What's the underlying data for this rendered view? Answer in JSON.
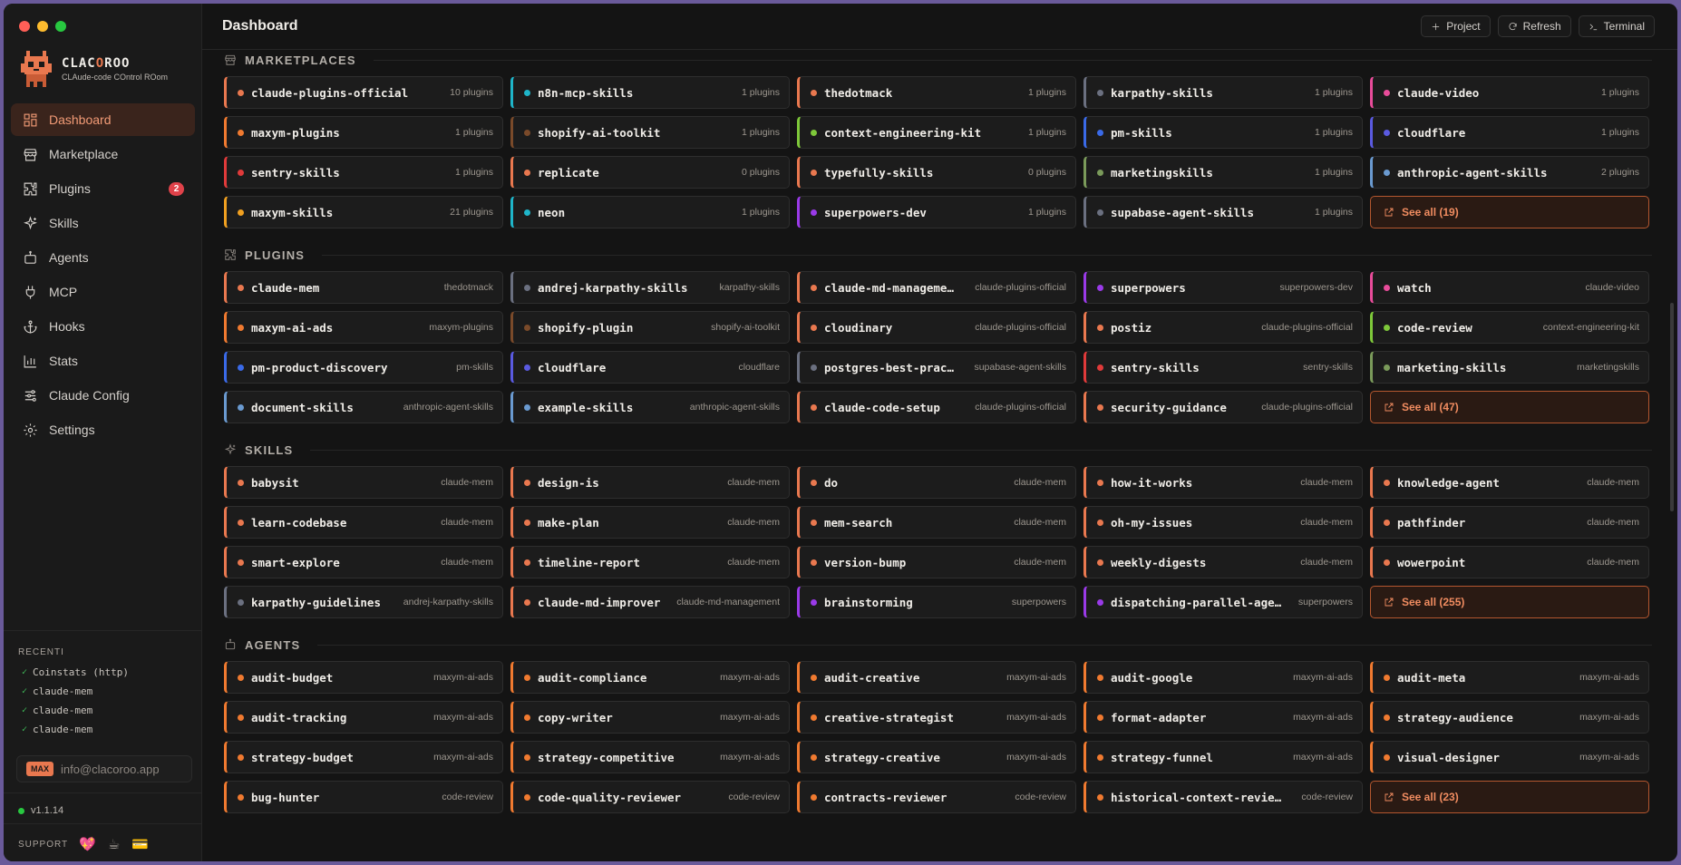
{
  "app": {
    "brand_name_a": "CLAC",
    "brand_name_b": "O",
    "brand_name_c": "ROO",
    "brand_sub": "CLAude-code COntrol ROom"
  },
  "sidebar": {
    "items": [
      {
        "id": "dashboard",
        "label": "Dashboard",
        "icon": "dashboard-icon",
        "active": true
      },
      {
        "id": "marketplace",
        "label": "Marketplace",
        "icon": "store-icon"
      },
      {
        "id": "plugins",
        "label": "Plugins",
        "icon": "puzzle-icon",
        "badge": "2"
      },
      {
        "id": "skills",
        "label": "Skills",
        "icon": "sparkles-icon"
      },
      {
        "id": "agents",
        "label": "Agents",
        "icon": "robot-icon"
      },
      {
        "id": "mcp",
        "label": "MCP",
        "icon": "plug-icon"
      },
      {
        "id": "hooks",
        "label": "Hooks",
        "icon": "anchor-icon"
      },
      {
        "id": "stats",
        "label": "Stats",
        "icon": "bar-chart-icon"
      },
      {
        "id": "claude-config",
        "label": "Claude Config",
        "icon": "sliders-icon"
      },
      {
        "id": "settings",
        "label": "Settings",
        "icon": "gear-icon"
      }
    ],
    "recent_title": "RECENTI",
    "recent": [
      "Coinstats (http)",
      "claude-mem",
      "claude-mem",
      "claude-mem"
    ],
    "plan_badge": "MAX",
    "email": "info@clacoroo.app",
    "version": "v1.1.14",
    "support_label": "SUPPORT"
  },
  "header": {
    "title": "Dashboard",
    "actions": [
      {
        "id": "project",
        "label": "Project",
        "icon": "plus-icon"
      },
      {
        "id": "refresh",
        "label": "Refresh",
        "icon": "refresh-icon"
      },
      {
        "id": "terminal",
        "label": "Terminal",
        "icon": "terminal-icon"
      }
    ]
  },
  "sections": [
    {
      "id": "marketplaces",
      "title": "MARKETPLACES",
      "icon": "store-icon",
      "cards": [
        {
          "name": "claude-plugins-official",
          "meta": "10 plugins",
          "color": "#e9784f"
        },
        {
          "name": "n8n-mcp-skills",
          "meta": "1 plugins",
          "color": "#1fb5c9"
        },
        {
          "name": "thedotmack",
          "meta": "1 plugins",
          "color": "#e9784f"
        },
        {
          "name": "karpathy-skills",
          "meta": "1 plugins",
          "color": "#6b7080"
        },
        {
          "name": "claude-video",
          "meta": "1 plugins",
          "color": "#e84c9a"
        },
        {
          "name": "maxym-plugins",
          "meta": "1 plugins",
          "color": "#f07a30"
        },
        {
          "name": "shopify-ai-toolkit",
          "meta": "1 plugins",
          "color": "#7a4a2a"
        },
        {
          "name": "context-engineering-kit",
          "meta": "1 plugins",
          "color": "#7ec83a"
        },
        {
          "name": "pm-skills",
          "meta": "1 plugins",
          "color": "#3a6ae8"
        },
        {
          "name": "cloudflare",
          "meta": "1 plugins",
          "color": "#5a5ae0"
        },
        {
          "name": "sentry-skills",
          "meta": "1 plugins",
          "color": "#e03a3a"
        },
        {
          "name": "replicate",
          "meta": "0 plugins",
          "color": "#e9784f"
        },
        {
          "name": "typefully-skills",
          "meta": "0 plugins",
          "color": "#e9784f"
        },
        {
          "name": "marketingskills",
          "meta": "1 plugins",
          "color": "#7a9a5a"
        },
        {
          "name": "anthropic-agent-skills",
          "meta": "2 plugins",
          "color": "#6a9ad0"
        },
        {
          "name": "maxym-skills",
          "meta": "21 plugins",
          "color": "#f0a020"
        },
        {
          "name": "neon",
          "meta": "1 plugins",
          "color": "#1fb5c9"
        },
        {
          "name": "superpowers-dev",
          "meta": "1 plugins",
          "color": "#9a3ae8"
        },
        {
          "name": "supabase-agent-skills",
          "meta": "1 plugins",
          "color": "#6b7080"
        }
      ],
      "see_all": "See all (19)"
    },
    {
      "id": "plugins",
      "title": "PLUGINS",
      "icon": "puzzle-icon",
      "cards": [
        {
          "name": "claude-mem",
          "meta": "thedotmack",
          "color": "#e9784f"
        },
        {
          "name": "andrej-karpathy-skills",
          "meta": "karpathy-skills",
          "color": "#6b7080"
        },
        {
          "name": "claude-md-management",
          "meta": "claude-plugins-official",
          "color": "#e9784f"
        },
        {
          "name": "superpowers",
          "meta": "superpowers-dev",
          "color": "#9a3ae8"
        },
        {
          "name": "watch",
          "meta": "claude-video",
          "color": "#e84c9a"
        },
        {
          "name": "maxym-ai-ads",
          "meta": "maxym-plugins",
          "color": "#f07a30"
        },
        {
          "name": "shopify-plugin",
          "meta": "shopify-ai-toolkit",
          "color": "#7a4a2a"
        },
        {
          "name": "cloudinary",
          "meta": "claude-plugins-official",
          "color": "#e9784f"
        },
        {
          "name": "postiz",
          "meta": "claude-plugins-official",
          "color": "#e9784f"
        },
        {
          "name": "code-review",
          "meta": "context-engineering-kit",
          "color": "#7ec83a"
        },
        {
          "name": "pm-product-discovery",
          "meta": "pm-skills",
          "color": "#3a6ae8"
        },
        {
          "name": "cloudflare",
          "meta": "cloudflare",
          "color": "#5a5ae0"
        },
        {
          "name": "postgres-best-pract…",
          "meta": "supabase-agent-skills",
          "color": "#6b7080"
        },
        {
          "name": "sentry-skills",
          "meta": "sentry-skills",
          "color": "#e03a3a"
        },
        {
          "name": "marketing-skills",
          "meta": "marketingskills",
          "color": "#7a9a5a"
        },
        {
          "name": "document-skills",
          "meta": "anthropic-agent-skills",
          "color": "#6a9ad0"
        },
        {
          "name": "example-skills",
          "meta": "anthropic-agent-skills",
          "color": "#6a9ad0"
        },
        {
          "name": "claude-code-setup",
          "meta": "claude-plugins-official",
          "color": "#e9784f"
        },
        {
          "name": "security-guidance",
          "meta": "claude-plugins-official",
          "color": "#e9784f"
        }
      ],
      "see_all": "See all (47)"
    },
    {
      "id": "skills",
      "title": "SKILLS",
      "icon": "sparkles-icon",
      "cards": [
        {
          "name": "babysit",
          "meta": "claude-mem",
          "color": "#e9784f"
        },
        {
          "name": "design-is",
          "meta": "claude-mem",
          "color": "#e9784f"
        },
        {
          "name": "do",
          "meta": "claude-mem",
          "color": "#e9784f"
        },
        {
          "name": "how-it-works",
          "meta": "claude-mem",
          "color": "#e9784f"
        },
        {
          "name": "knowledge-agent",
          "meta": "claude-mem",
          "color": "#e9784f"
        },
        {
          "name": "learn-codebase",
          "meta": "claude-mem",
          "color": "#e9784f"
        },
        {
          "name": "make-plan",
          "meta": "claude-mem",
          "color": "#e9784f"
        },
        {
          "name": "mem-search",
          "meta": "claude-mem",
          "color": "#e9784f"
        },
        {
          "name": "oh-my-issues",
          "meta": "claude-mem",
          "color": "#e9784f"
        },
        {
          "name": "pathfinder",
          "meta": "claude-mem",
          "color": "#e9784f"
        },
        {
          "name": "smart-explore",
          "meta": "claude-mem",
          "color": "#e9784f"
        },
        {
          "name": "timeline-report",
          "meta": "claude-mem",
          "color": "#e9784f"
        },
        {
          "name": "version-bump",
          "meta": "claude-mem",
          "color": "#e9784f"
        },
        {
          "name": "weekly-digests",
          "meta": "claude-mem",
          "color": "#e9784f"
        },
        {
          "name": "wowerpoint",
          "meta": "claude-mem",
          "color": "#e9784f"
        },
        {
          "name": "karpathy-guidelines",
          "meta": "andrej-karpathy-skills",
          "color": "#6b7080"
        },
        {
          "name": "claude-md-improver",
          "meta": "claude-md-management",
          "color": "#e9784f"
        },
        {
          "name": "brainstorming",
          "meta": "superpowers",
          "color": "#9a3ae8"
        },
        {
          "name": "dispatching-parallel-agen…",
          "meta": "superpowers",
          "color": "#9a3ae8"
        }
      ],
      "see_all": "See all (255)"
    },
    {
      "id": "agents",
      "title": "AGENTS",
      "icon": "robot-icon",
      "cards": [
        {
          "name": "audit-budget",
          "meta": "maxym-ai-ads",
          "color": "#f07a30"
        },
        {
          "name": "audit-compliance",
          "meta": "maxym-ai-ads",
          "color": "#f07a30"
        },
        {
          "name": "audit-creative",
          "meta": "maxym-ai-ads",
          "color": "#f07a30"
        },
        {
          "name": "audit-google",
          "meta": "maxym-ai-ads",
          "color": "#f07a30"
        },
        {
          "name": "audit-meta",
          "meta": "maxym-ai-ads",
          "color": "#f07a30"
        },
        {
          "name": "audit-tracking",
          "meta": "maxym-ai-ads",
          "color": "#f07a30"
        },
        {
          "name": "copy-writer",
          "meta": "maxym-ai-ads",
          "color": "#f07a30"
        },
        {
          "name": "creative-strategist",
          "meta": "maxym-ai-ads",
          "color": "#f07a30"
        },
        {
          "name": "format-adapter",
          "meta": "maxym-ai-ads",
          "color": "#f07a30"
        },
        {
          "name": "strategy-audience",
          "meta": "maxym-ai-ads",
          "color": "#f07a30"
        },
        {
          "name": "strategy-budget",
          "meta": "maxym-ai-ads",
          "color": "#f07a30"
        },
        {
          "name": "strategy-competitive",
          "meta": "maxym-ai-ads",
          "color": "#f07a30"
        },
        {
          "name": "strategy-creative",
          "meta": "maxym-ai-ads",
          "color": "#f07a30"
        },
        {
          "name": "strategy-funnel",
          "meta": "maxym-ai-ads",
          "color": "#f07a30"
        },
        {
          "name": "visual-designer",
          "meta": "maxym-ai-ads",
          "color": "#f07a30"
        },
        {
          "name": "bug-hunter",
          "meta": "code-review",
          "color": "#f07a30"
        },
        {
          "name": "code-quality-reviewer",
          "meta": "code-review",
          "color": "#f07a30"
        },
        {
          "name": "contracts-reviewer",
          "meta": "code-review",
          "color": "#f07a30"
        },
        {
          "name": "historical-context-reviewer",
          "meta": "code-review",
          "color": "#f07a30"
        }
      ],
      "see_all": "See all (23)"
    }
  ]
}
